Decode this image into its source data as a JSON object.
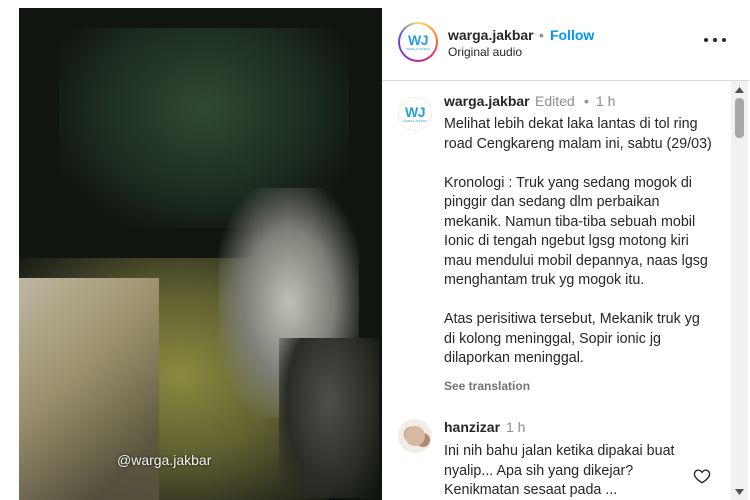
{
  "video": {
    "watermark": "@warga.jakbar"
  },
  "header": {
    "username": "warga.jakbar",
    "separator": "•",
    "follow_label": "Follow",
    "audio": "Original audio",
    "avatar_text": "WJ",
    "avatar_subtext": "WARGA JAKBAR"
  },
  "caption": {
    "username": "warga.jakbar",
    "edited": "Edited",
    "separator": "•",
    "time": "1 h",
    "text": "Melihat lebih dekat laka lantas di tol ring road Cengkareng malam ini, sabtu (29/03)\n\nKronologi : Truk yang sedang mogok di pinggir dan sedang dlm perbaikan mekanik. Namun tiba-tiba sebuah mobil Ionic di tengah ngebut lgsg motong kiri mau mendului mobil depannya, naas lgsg menghantam truk yg mogok itu.\n\nAtas perisitiwa tersebut, Mekanik truk yg di kolong meninggal, Sopir ionic jg dilaporkan meninggal.",
    "see_translation": "See translation"
  },
  "comments": [
    {
      "username": "hanzizar",
      "time": "1 h",
      "text": "Ini nih bahu jalan ketika dipakai buat nyalip... Apa sih yang dikejar?\nKenikmatan sesaat pada ..."
    }
  ],
  "icons": {
    "more": "more-horizontal-icon",
    "like": "heart-icon"
  }
}
